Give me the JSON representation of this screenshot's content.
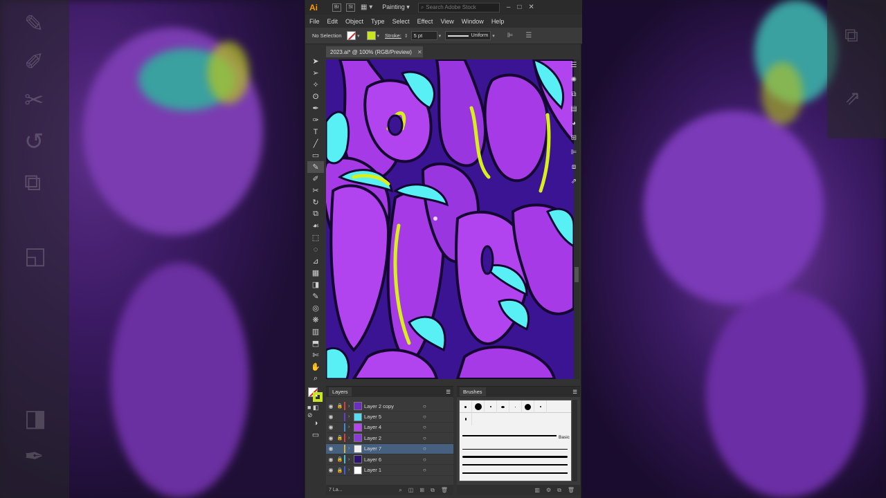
{
  "app": {
    "logo": "Ai",
    "bridge_label": "Br",
    "stock_label": "St",
    "workspace": "Painting",
    "search_placeholder": "Search Adobe Stock"
  },
  "menu": [
    "File",
    "Edit",
    "Object",
    "Type",
    "Select",
    "Effect",
    "View",
    "Window",
    "Help"
  ],
  "control": {
    "selection": "No Selection",
    "stroke_label": "Stroke:",
    "stroke_weight": "5 pt",
    "profile": "Uniform",
    "fill_color": "#ffffff",
    "stroke_color": "#c8e61e"
  },
  "document": {
    "tab_title": "2023.ai* @ 100% (RGB/Preview)"
  },
  "layers": {
    "title": "Layers",
    "footer": "7 La...",
    "items": [
      {
        "name": "Layer 2 copy",
        "color": "#e03c3c",
        "locked": true,
        "selected": false
      },
      {
        "name": "Layer 5",
        "color": "#6a3cd0",
        "locked": false,
        "selected": false
      },
      {
        "name": "Layer 4",
        "color": "#3c8ce0",
        "locked": false,
        "selected": false
      },
      {
        "name": "Layer 2",
        "color": "#e03c3c",
        "locked": true,
        "selected": false
      },
      {
        "name": "Layer 7",
        "color": "#e0b03c",
        "locked": false,
        "selected": true
      },
      {
        "name": "Layer 6",
        "color": "#3cc0e0",
        "locked": true,
        "selected": false
      },
      {
        "name": "Layer 1",
        "color": "#3c60e0",
        "locked": true,
        "selected": false
      }
    ]
  },
  "brushes": {
    "title": "Brushes",
    "basic_label": "Basic"
  },
  "icons": {
    "close": "close-icon",
    "eye": "eye-icon",
    "lock": "lock-icon"
  }
}
